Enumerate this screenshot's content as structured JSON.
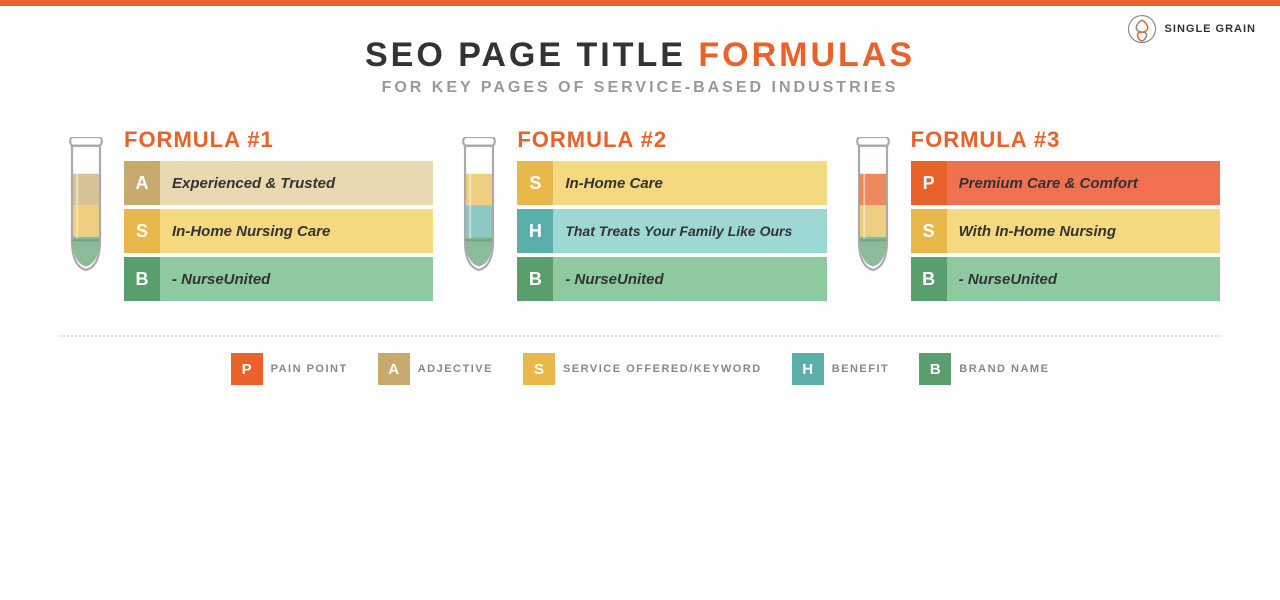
{
  "topBar": {
    "color": "#e8622a"
  },
  "logo": {
    "text": "SINGLE GRAIN"
  },
  "header": {
    "title_black": "SEO PAGE TITLE ",
    "title_orange": "FORMULAS",
    "subtitle": "FOR KEY PAGES OF SERVICE-BASED INDUSTRIES"
  },
  "formulas": [
    {
      "id": "formula1",
      "title": "FORMULA #1",
      "rows": [
        {
          "letter": "A",
          "letterColor": "color-tan",
          "bgColor": "bg-tan",
          "text": "Experienced & Trusted"
        },
        {
          "letter": "S",
          "letterColor": "color-gold",
          "bgColor": "bg-gold",
          "text": "In-Home Nursing Care"
        },
        {
          "letter": "B",
          "letterColor": "color-green",
          "bgColor": "bg-green",
          "text": "- NurseUnited"
        }
      ]
    },
    {
      "id": "formula2",
      "title": "FORMULA #2",
      "rows": [
        {
          "letter": "S",
          "letterColor": "color-gold",
          "bgColor": "bg-gold",
          "text": "In-Home Care"
        },
        {
          "letter": "H",
          "letterColor": "color-teal",
          "bgColor": "bg-teal",
          "text": "That Treats Your Family Like Ours"
        },
        {
          "letter": "B",
          "letterColor": "color-green",
          "bgColor": "bg-green",
          "text": "- NurseUnited"
        }
      ]
    },
    {
      "id": "formula3",
      "title": "FORMULA #3",
      "rows": [
        {
          "letter": "P",
          "letterColor": "color-red",
          "bgColor": "bg-red",
          "text": "Premium Care & Comfort"
        },
        {
          "letter": "S",
          "letterColor": "color-gold",
          "bgColor": "bg-gold",
          "text": "With In-Home Nursing"
        },
        {
          "letter": "B",
          "letterColor": "color-green",
          "bgColor": "bg-green",
          "text": "- NurseUnited"
        }
      ]
    }
  ],
  "legend": [
    {
      "id": "legend-p",
      "letter": "P",
      "color": "color-red",
      "label": "PAIN POINT"
    },
    {
      "id": "legend-a",
      "letter": "A",
      "color": "color-tan",
      "label": "ADJECTIVE"
    },
    {
      "id": "legend-s",
      "letter": "S",
      "color": "color-gold",
      "label": "SERVICE OFFERED/KEYWORD"
    },
    {
      "id": "legend-h",
      "letter": "H",
      "color": "color-teal",
      "label": "BENEFIT"
    },
    {
      "id": "legend-b",
      "letter": "B",
      "color": "color-green",
      "label": "BRAND NAME"
    }
  ]
}
